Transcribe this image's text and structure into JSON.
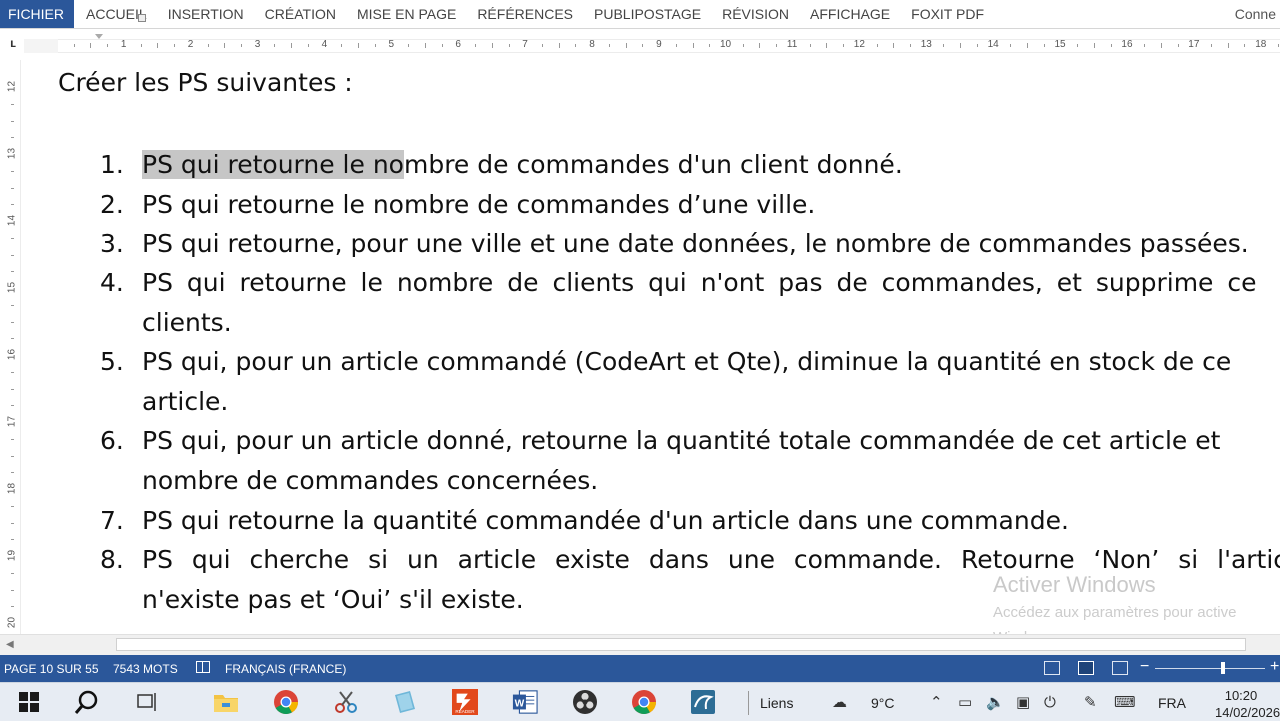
{
  "ribbon": {
    "file_tab": "FICHIER",
    "tabs": [
      "ACCUEIL",
      "INSERTION",
      "CRÉATION",
      "MISE EN PAGE",
      "RÉFÉRENCES",
      "PUBLIPOSTAGE",
      "RÉVISION",
      "AFFICHAGE",
      "FOXIT PDF"
    ],
    "account": "Conne"
  },
  "ruler": {
    "corner": "L",
    "numbers": [
      "1",
      "2",
      "3",
      "4",
      "5",
      "6",
      "7",
      "8",
      "9",
      "10",
      "11",
      "12",
      "13",
      "14",
      "15",
      "16",
      "17",
      "18"
    ],
    "vertical_numbers": [
      "12",
      "13",
      "14",
      "15",
      "16",
      "17",
      "18",
      "19",
      "20"
    ]
  },
  "document": {
    "heading": "Créer les PS suivantes :",
    "items": [
      {
        "num": "1.",
        "lines": [
          "PS qui retourne le nombre de commandes d'un client donné."
        ],
        "selected": "PS qui retourne le no"
      },
      {
        "num": "2.",
        "lines": [
          "PS qui retourne le nombre de commandes d’une ville."
        ]
      },
      {
        "num": "3.",
        "lines": [
          "PS qui retourne, pour une ville et une date données, le nombre de commandes passées."
        ]
      },
      {
        "num": "4.",
        "lines": [
          "PS qui retourne le nombre de clients qui n'ont pas de commandes, et supprime ce",
          "clients."
        ]
      },
      {
        "num": "5.",
        "lines": [
          "PS qui, pour un article commandé (CodeArt et Qte), diminue la quantité en stock de ce",
          "article."
        ]
      },
      {
        "num": "6.",
        "lines": [
          "PS qui, pour un article donné, retourne la quantité totale commandée de cet article et",
          "nombre de commandes concernées."
        ]
      },
      {
        "num": "7.",
        "lines": [
          "PS qui retourne la quantité commandée d'un article dans une commande."
        ]
      },
      {
        "num": "8.",
        "lines": [
          "PS qui cherche si un article existe dans une commande. Retourne ‘Non’ si l'artic",
          "n'existe pas et ‘Oui’ s'il existe."
        ]
      }
    ]
  },
  "watermark": {
    "title": "Activer Windows",
    "line1": "Accédez aux paramètres pour active",
    "line2": "Windows."
  },
  "status": {
    "page": "PAGE 10 SUR 55",
    "words": "7543 MOTS",
    "language": "FRANÇAIS (FRANCE)",
    "zoom_level": 0.6
  },
  "taskbar": {
    "links": "Liens",
    "temperature": "9°C",
    "language": "FRA",
    "time": "10:20",
    "date": "14/02/2026"
  }
}
